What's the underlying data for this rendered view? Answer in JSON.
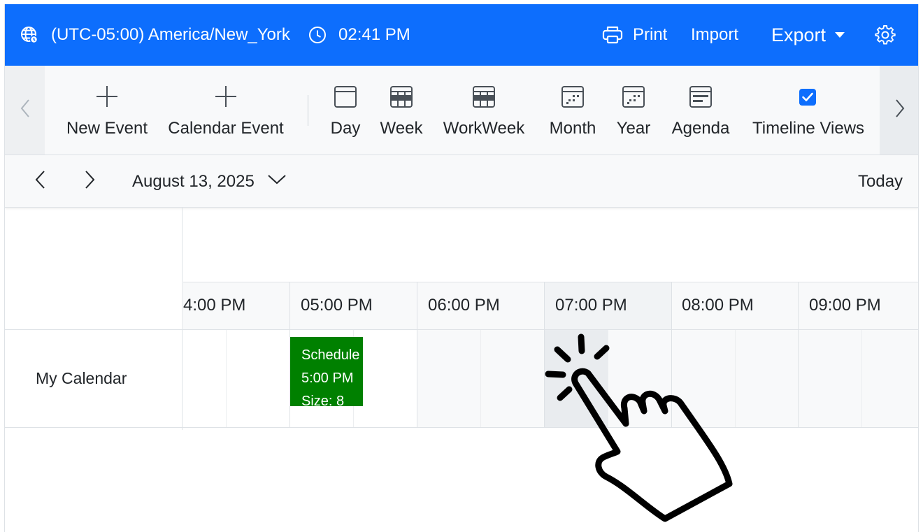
{
  "header": {
    "timezone": "(UTC-05:00) America/New_York",
    "time": "02:41 PM",
    "print_label": "Print",
    "import_label": "Import",
    "export_label": "Export",
    "icons": [
      "globe-icon",
      "clock-icon",
      "printer-icon",
      "chevron-down-icon",
      "gear-icon"
    ]
  },
  "toolbar": {
    "new_event": "New Event",
    "calendar_event": "Calendar Event",
    "views": {
      "day": "Day",
      "week": "Week",
      "workweek": "WorkWeek",
      "month": "Month",
      "year": "Year",
      "agenda": "Agenda",
      "timeline": "Timeline Views"
    },
    "timeline_checked": true
  },
  "datebar": {
    "date": "August 13, 2025",
    "today": "Today"
  },
  "timeline": {
    "hours": [
      "4:00 PM",
      "05:00 PM",
      "06:00 PM",
      "07:00 PM",
      "08:00 PM",
      "09:00 PM"
    ],
    "resource": "My Calendar",
    "event": {
      "title": "Schedule",
      "time": "5:00 PM",
      "size": "Size: 8",
      "color": "#008000"
    }
  },
  "colors": {
    "primary": "#0d6efd",
    "toolbar_bg": "#f8f9fa",
    "border": "#dee2e6"
  }
}
